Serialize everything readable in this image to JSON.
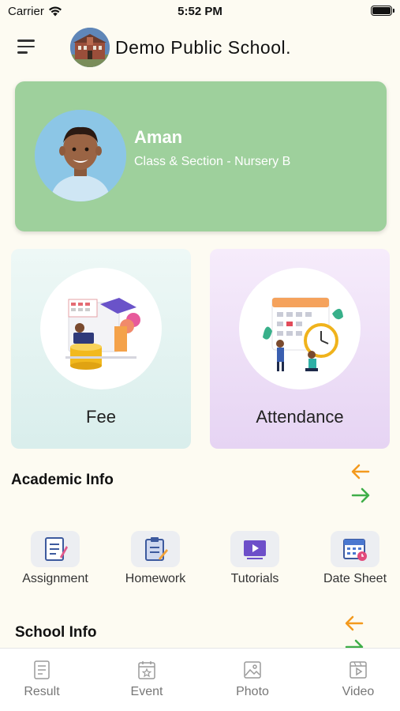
{
  "status_bar": {
    "carrier": "Carrier",
    "time": "5:52 PM"
  },
  "header": {
    "school_name": "Demo Public School."
  },
  "profile": {
    "name": "Aman",
    "class_section": "Class & Section - Nursery B"
  },
  "tiles": [
    {
      "label": "Fee",
      "icon": "fee-illustration-icon"
    },
    {
      "label": "Attendance",
      "icon": "attendance-illustration-icon"
    }
  ],
  "academic_info": {
    "title": "Academic Info",
    "items": [
      {
        "label": "Assignment",
        "icon": "assignment-icon"
      },
      {
        "label": "Homework",
        "icon": "homework-icon"
      },
      {
        "label": "Tutorials",
        "icon": "tutorials-icon"
      },
      {
        "label": "Date Sheet",
        "icon": "date-sheet-icon"
      }
    ]
  },
  "school_info": {
    "title": "School Info"
  },
  "tabbar": {
    "items": [
      {
        "label": "Result",
        "icon": "result-icon"
      },
      {
        "label": "Event",
        "icon": "event-icon"
      },
      {
        "label": "Photo",
        "icon": "photo-icon"
      },
      {
        "label": "Video",
        "icon": "video-icon"
      }
    ]
  },
  "colors": {
    "profile_card": "#9ed09c",
    "fee_tile": "#d9eeec",
    "attendance_tile": "#e6d4f3",
    "arrow_left": "#f39a1e",
    "arrow_right": "#3fae49"
  }
}
